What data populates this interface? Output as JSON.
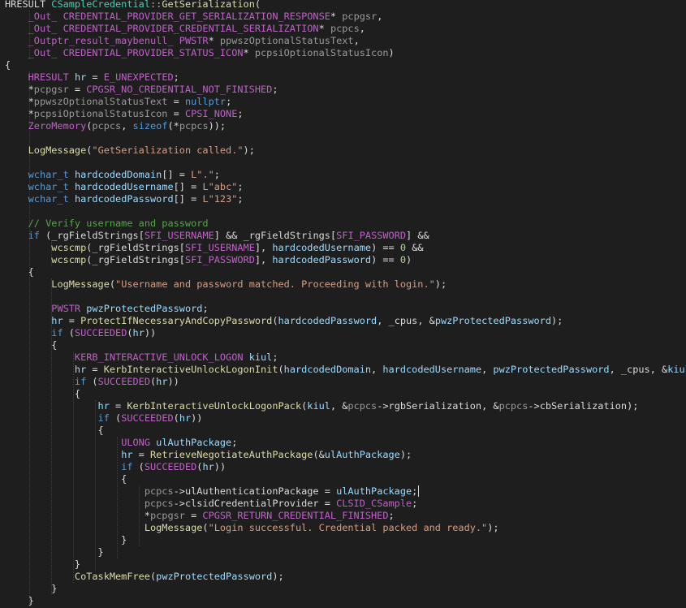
{
  "editor": {
    "language": "cpp",
    "theme": {
      "background": "#1e1e1e",
      "keyword": "#569cd6",
      "type": "#4ec9b0",
      "function": "#dcdcaa",
      "variable": "#9cdcfe",
      "macro": "#bd63c5",
      "string": "#d69d85",
      "number": "#b5cea8",
      "comment": "#57a64a"
    },
    "lines": [
      [
        [
          "pl",
          "HRESULT "
        ],
        [
          "ty",
          "CSampleCredential"
        ],
        [
          "op",
          "::"
        ],
        [
          "fn",
          "GetSerialization"
        ],
        [
          "pl",
          "("
        ]
      ],
      [
        [
          "pl",
          "    "
        ],
        [
          "mac",
          "_Out_"
        ],
        [
          "pl",
          " "
        ],
        [
          "mac",
          "CREDENTIAL_PROVIDER_GET_SERIALIZATION_RESPONSE"
        ],
        [
          "pl",
          "* "
        ],
        [
          "prm",
          "pcpgsr"
        ],
        [
          "pl",
          ","
        ]
      ],
      [
        [
          "pl",
          "    "
        ],
        [
          "mac",
          "_Out_"
        ],
        [
          "pl",
          " "
        ],
        [
          "mac",
          "CREDENTIAL_PROVIDER_CREDENTIAL_SERIALIZATION"
        ],
        [
          "pl",
          "* "
        ],
        [
          "prm",
          "pcpcs"
        ],
        [
          "pl",
          ","
        ]
      ],
      [
        [
          "pl",
          "    "
        ],
        [
          "mac",
          "_Outptr_result_maybenull_"
        ],
        [
          "pl",
          " "
        ],
        [
          "mac",
          "PWSTR"
        ],
        [
          "pl",
          "* "
        ],
        [
          "prm",
          "ppwszOptionalStatusText"
        ],
        [
          "pl",
          ","
        ]
      ],
      [
        [
          "pl",
          "    "
        ],
        [
          "mac",
          "_Out_"
        ],
        [
          "pl",
          " "
        ],
        [
          "mac",
          "CREDENTIAL_PROVIDER_STATUS_ICON"
        ],
        [
          "pl",
          "* "
        ],
        [
          "prm",
          "pcpsiOptionalStatusIcon"
        ],
        [
          "pl",
          ")"
        ]
      ],
      [
        [
          "pl",
          "{"
        ]
      ],
      [
        [
          "pl",
          "    "
        ],
        [
          "mac",
          "HRESULT"
        ],
        [
          "pl",
          " "
        ],
        [
          "id",
          "hr"
        ],
        [
          "pl",
          " = "
        ],
        [
          "mac",
          "E_UNEXPECTED"
        ],
        [
          "pl",
          ";"
        ]
      ],
      [
        [
          "pl",
          "    *"
        ],
        [
          "prm",
          "pcpgsr"
        ],
        [
          "pl",
          " = "
        ],
        [
          "mac",
          "CPGSR_NO_CREDENTIAL_NOT_FINISHED"
        ],
        [
          "pl",
          ";"
        ]
      ],
      [
        [
          "pl",
          "    *"
        ],
        [
          "prm",
          "ppwszOptionalStatusText"
        ],
        [
          "pl",
          " = "
        ],
        [
          "kw",
          "nullptr"
        ],
        [
          "pl",
          ";"
        ]
      ],
      [
        [
          "pl",
          "    *"
        ],
        [
          "prm",
          "pcpsiOptionalStatusIcon"
        ],
        [
          "pl",
          " = "
        ],
        [
          "mac",
          "CPSI_NONE"
        ],
        [
          "pl",
          ";"
        ]
      ],
      [
        [
          "pl",
          "    "
        ],
        [
          "mac",
          "ZeroMemory"
        ],
        [
          "pl",
          "("
        ],
        [
          "prm",
          "pcpcs"
        ],
        [
          "pl",
          ", "
        ],
        [
          "kw",
          "sizeof"
        ],
        [
          "pl",
          "(*"
        ],
        [
          "prm",
          "pcpcs"
        ],
        [
          "pl",
          "));"
        ]
      ],
      [
        [
          "pl",
          ""
        ]
      ],
      [
        [
          "pl",
          "    "
        ],
        [
          "fn",
          "LogMessage"
        ],
        [
          "pl",
          "("
        ],
        [
          "str",
          "\"GetSerialization called.\""
        ],
        [
          "pl",
          ");"
        ]
      ],
      [
        [
          "pl",
          ""
        ]
      ],
      [
        [
          "pl",
          "    "
        ],
        [
          "kw",
          "wchar_t"
        ],
        [
          "pl",
          " "
        ],
        [
          "id",
          "hardcodedDomain"
        ],
        [
          "pl",
          "[] = "
        ],
        [
          "str",
          "L\".\""
        ],
        [
          "pl",
          ";"
        ]
      ],
      [
        [
          "pl",
          "    "
        ],
        [
          "kw",
          "wchar_t"
        ],
        [
          "pl",
          " "
        ],
        [
          "id",
          "hardcodedUsername"
        ],
        [
          "pl",
          "[] = "
        ],
        [
          "str",
          "L\"abc\""
        ],
        [
          "pl",
          ";"
        ]
      ],
      [
        [
          "pl",
          "    "
        ],
        [
          "kw",
          "wchar_t"
        ],
        [
          "pl",
          " "
        ],
        [
          "id",
          "hardcodedPassword"
        ],
        [
          "pl",
          "[] = "
        ],
        [
          "str",
          "L\"123\""
        ],
        [
          "pl",
          ";"
        ]
      ],
      [
        [
          "pl",
          ""
        ]
      ],
      [
        [
          "pl",
          "    "
        ],
        [
          "cm",
          "// Verify username and password"
        ]
      ],
      [
        [
          "pl",
          "    "
        ],
        [
          "kw",
          "if"
        ],
        [
          "pl",
          " ("
        ],
        [
          "fld",
          "_rgFieldStrings"
        ],
        [
          "pl",
          "["
        ],
        [
          "mac",
          "SFI_USERNAME"
        ],
        [
          "pl",
          "] && "
        ],
        [
          "fld",
          "_rgFieldStrings"
        ],
        [
          "pl",
          "["
        ],
        [
          "mac",
          "SFI_PASSWORD"
        ],
        [
          "pl",
          "] &&"
        ]
      ],
      [
        [
          "pl",
          "        "
        ],
        [
          "fn",
          "wcscmp"
        ],
        [
          "pl",
          "("
        ],
        [
          "fld",
          "_rgFieldStrings"
        ],
        [
          "pl",
          "["
        ],
        [
          "mac",
          "SFI_USERNAME"
        ],
        [
          "pl",
          "], "
        ],
        [
          "id",
          "hardcodedUsername"
        ],
        [
          "pl",
          ") == "
        ],
        [
          "num",
          "0"
        ],
        [
          "pl",
          " &&"
        ]
      ],
      [
        [
          "pl",
          "        "
        ],
        [
          "fn",
          "wcscmp"
        ],
        [
          "pl",
          "("
        ],
        [
          "fld",
          "_rgFieldStrings"
        ],
        [
          "pl",
          "["
        ],
        [
          "mac",
          "SFI_PASSWORD"
        ],
        [
          "pl",
          "], "
        ],
        [
          "id",
          "hardcodedPassword"
        ],
        [
          "pl",
          ") == "
        ],
        [
          "num",
          "0"
        ],
        [
          "pl",
          ")"
        ]
      ],
      [
        [
          "pl",
          "    {"
        ]
      ],
      [
        [
          "pl",
          "        "
        ],
        [
          "fn",
          "LogMessage"
        ],
        [
          "pl",
          "("
        ],
        [
          "str",
          "\"Username and password matched. Proceeding with login.\""
        ],
        [
          "pl",
          ");"
        ]
      ],
      [
        [
          "pl",
          ""
        ]
      ],
      [
        [
          "pl",
          "        "
        ],
        [
          "mac",
          "PWSTR"
        ],
        [
          "pl",
          " "
        ],
        [
          "id",
          "pwzProtectedPassword"
        ],
        [
          "pl",
          ";"
        ]
      ],
      [
        [
          "pl",
          "        "
        ],
        [
          "id",
          "hr"
        ],
        [
          "pl",
          " = "
        ],
        [
          "fn",
          "ProtectIfNecessaryAndCopyPassword"
        ],
        [
          "pl",
          "("
        ],
        [
          "id",
          "hardcodedPassword"
        ],
        [
          "pl",
          ", "
        ],
        [
          "fld",
          "_cpus"
        ],
        [
          "pl",
          ", &"
        ],
        [
          "id",
          "pwzProtectedPassword"
        ],
        [
          "pl",
          ");"
        ]
      ],
      [
        [
          "pl",
          "        "
        ],
        [
          "kw",
          "if"
        ],
        [
          "pl",
          " ("
        ],
        [
          "mac",
          "SUCCEEDED"
        ],
        [
          "pl",
          "("
        ],
        [
          "id",
          "hr"
        ],
        [
          "pl",
          "))"
        ]
      ],
      [
        [
          "pl",
          "        {"
        ]
      ],
      [
        [
          "pl",
          "            "
        ],
        [
          "mac",
          "KERB_INTERACTIVE_UNLOCK_LOGON"
        ],
        [
          "pl",
          " "
        ],
        [
          "id",
          "kiul"
        ],
        [
          "pl",
          ";"
        ]
      ],
      [
        [
          "pl",
          "            "
        ],
        [
          "id",
          "hr"
        ],
        [
          "pl",
          " = "
        ],
        [
          "fn",
          "KerbInteractiveUnlockLogonInit"
        ],
        [
          "pl",
          "("
        ],
        [
          "id",
          "hardcodedDomain"
        ],
        [
          "pl",
          ", "
        ],
        [
          "id",
          "hardcodedUsername"
        ],
        [
          "pl",
          ", "
        ],
        [
          "id",
          "pwzProtectedPassword"
        ],
        [
          "pl",
          ", "
        ],
        [
          "fld",
          "_cpus"
        ],
        [
          "pl",
          ", &"
        ],
        [
          "id",
          "kiul"
        ],
        [
          "pl",
          ");"
        ]
      ],
      [
        [
          "pl",
          "            "
        ],
        [
          "kw",
          "if"
        ],
        [
          "pl",
          " ("
        ],
        [
          "mac",
          "SUCCEEDED"
        ],
        [
          "pl",
          "("
        ],
        [
          "id",
          "hr"
        ],
        [
          "pl",
          "))"
        ]
      ],
      [
        [
          "pl",
          "            {"
        ]
      ],
      [
        [
          "pl",
          "                "
        ],
        [
          "id",
          "hr"
        ],
        [
          "pl",
          " = "
        ],
        [
          "fn",
          "KerbInteractiveUnlockLogonPack"
        ],
        [
          "pl",
          "("
        ],
        [
          "id",
          "kiul"
        ],
        [
          "pl",
          ", &"
        ],
        [
          "prm",
          "pcpcs"
        ],
        [
          "pl",
          "->"
        ],
        [
          "fld",
          "rgbSerialization"
        ],
        [
          "pl",
          ", &"
        ],
        [
          "prm",
          "pcpcs"
        ],
        [
          "pl",
          "->"
        ],
        [
          "fld",
          "cbSerialization"
        ],
        [
          "pl",
          ");"
        ]
      ],
      [
        [
          "pl",
          "                "
        ],
        [
          "kw",
          "if"
        ],
        [
          "pl",
          " ("
        ],
        [
          "mac",
          "SUCCEEDED"
        ],
        [
          "pl",
          "("
        ],
        [
          "id",
          "hr"
        ],
        [
          "pl",
          "))"
        ]
      ],
      [
        [
          "pl",
          "                {"
        ]
      ],
      [
        [
          "pl",
          "                    "
        ],
        [
          "mac",
          "ULONG"
        ],
        [
          "pl",
          " "
        ],
        [
          "id",
          "ulAuthPackage"
        ],
        [
          "pl",
          ";"
        ]
      ],
      [
        [
          "pl",
          "                    "
        ],
        [
          "id",
          "hr"
        ],
        [
          "pl",
          " = "
        ],
        [
          "fn",
          "RetrieveNegotiateAuthPackage"
        ],
        [
          "pl",
          "(&"
        ],
        [
          "id",
          "ulAuthPackage"
        ],
        [
          "pl",
          ");"
        ]
      ],
      [
        [
          "pl",
          "                    "
        ],
        [
          "kw",
          "if"
        ],
        [
          "pl",
          " ("
        ],
        [
          "mac",
          "SUCCEEDED"
        ],
        [
          "pl",
          "("
        ],
        [
          "id",
          "hr"
        ],
        [
          "pl",
          "))"
        ]
      ],
      [
        [
          "pl",
          "                    {"
        ]
      ],
      [
        [
          "pl",
          "                        "
        ],
        [
          "prm",
          "pcpcs"
        ],
        [
          "pl",
          "->"
        ],
        [
          "fld",
          "ulAuthenticationPackage"
        ],
        [
          "pl",
          " = "
        ],
        [
          "id",
          "ulAuthPackage"
        ],
        [
          "pl",
          ";"
        ]
      ],
      [
        [
          "pl",
          "                        "
        ],
        [
          "prm",
          "pcpcs"
        ],
        [
          "pl",
          "->"
        ],
        [
          "fld",
          "clsidCredentialProvider"
        ],
        [
          "pl",
          " = "
        ],
        [
          "mac",
          "CLSID_CSample"
        ],
        [
          "pl",
          ";"
        ]
      ],
      [
        [
          "pl",
          "                        *"
        ],
        [
          "prm",
          "pcpgsr"
        ],
        [
          "pl",
          " = "
        ],
        [
          "mac",
          "CPGSR_RETURN_CREDENTIAL_FINISHED"
        ],
        [
          "pl",
          ";"
        ]
      ],
      [
        [
          "pl",
          "                        "
        ],
        [
          "fn",
          "LogMessage"
        ],
        [
          "pl",
          "("
        ],
        [
          "str",
          "\"Login successful. Credential packed and ready.\""
        ],
        [
          "pl",
          ");"
        ]
      ],
      [
        [
          "pl",
          "                    }"
        ]
      ],
      [
        [
          "pl",
          "                }"
        ]
      ],
      [
        [
          "pl",
          "            }"
        ]
      ],
      [
        [
          "pl",
          "            "
        ],
        [
          "fn",
          "CoTaskMemFree"
        ],
        [
          "pl",
          "("
        ],
        [
          "id",
          "pwzProtectedPassword"
        ],
        [
          "pl",
          ");"
        ]
      ],
      [
        [
          "pl",
          "        }"
        ]
      ],
      [
        [
          "pl",
          "    }"
        ]
      ]
    ]
  }
}
